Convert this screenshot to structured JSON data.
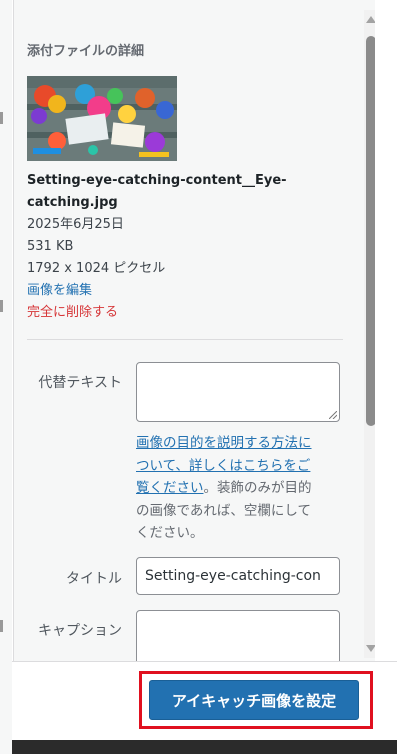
{
  "attachment_details": {
    "heading": "添付ファイルの詳細",
    "thumbnail_icon": "image-thumbnail",
    "filename": "Setting-eye-catching-content__Eye-catching.jpg",
    "filename_line1": "Setting-eye-catching-content__Eye-",
    "filename_line2": "catching.jpg",
    "date": "2025年6月25日",
    "filesize": "531 KB",
    "dimensions": "1792 x 1024 ピクセル",
    "edit_link": "画像を編集",
    "delete_link": "完全に削除する"
  },
  "fields": {
    "alt_text_label": "代替テキスト",
    "alt_text_value": "",
    "alt_help_link_line1": "画像の目的を説明する方法に",
    "alt_help_link_line2": "ついて、詳しくはこちらをご",
    "alt_help_link_line3": "覧ください",
    "alt_help_rest_line3": "。装飾のみが目的",
    "alt_help_line4": "の画像であれば、空欄にして",
    "alt_help_line5": "ください。",
    "title_label": "タイトル",
    "title_value": "Setting-eye-catching-con",
    "caption_label": "キャプション",
    "caption_value": ""
  },
  "footer": {
    "set_featured_button": "アイキャッチ画像を設定"
  },
  "colors": {
    "primary": "#2271b1",
    "delete": "#d63638",
    "highlight": "#e0101f"
  }
}
